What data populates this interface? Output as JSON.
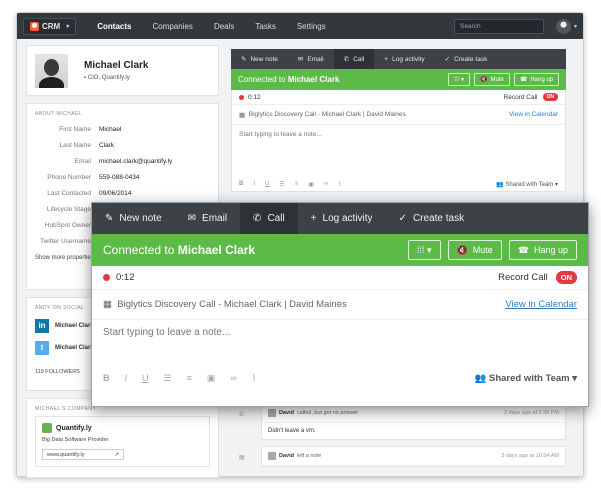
{
  "topnav": {
    "app_label": "CRM",
    "items": [
      "Contacts",
      "Companies",
      "Deals",
      "Tasks",
      "Settings"
    ],
    "search_placeholder": "Search"
  },
  "profile": {
    "name": "Michael Clark",
    "title": "CIO, Quantify.ly"
  },
  "about": {
    "section_label": "ABOUT MICHAEL",
    "fields": [
      {
        "label": "First Name",
        "value": "Michael"
      },
      {
        "label": "Last Name",
        "value": "Clark"
      },
      {
        "label": "Email",
        "value": "michael.clark@quantify.ly"
      },
      {
        "label": "Phone Number",
        "value": "559-088-0434"
      },
      {
        "label": "Last Contacted",
        "value": "09/06/2014"
      },
      {
        "label": "Lifecycle Stage",
        "value": ""
      },
      {
        "label": "HubSpot Owner",
        "value": ""
      },
      {
        "label": "Twitter Username",
        "value": ""
      }
    ],
    "show_more": "Show more properties"
  },
  "social": {
    "section_label": "ANDY ON SOCIAL",
    "linkedin_name": "Michael Clark",
    "twitter_name": "Michael Clark",
    "followers": "119 FOLLOWERS"
  },
  "company": {
    "section_label": "MICHAEL'S COMPANY",
    "name": "Quantify.ly",
    "description": "Big Data Software Provider",
    "url": "www.quantify.ly"
  },
  "composer": {
    "tabs": [
      "New note",
      "Email",
      "Call",
      "Log activity",
      "Create task"
    ],
    "connected_prefix": "Connected to",
    "contact": "Michael Clark",
    "mute": "Mute",
    "hangup": "Hang up",
    "timer": "0:12",
    "record_label": "Record Call",
    "record_toggle": "ON",
    "subject": "Biglytics Discovery Call - Michael Clark | David Maines",
    "calendar_link": "View in Calendar",
    "note_placeholder": "Start typing to leave a note...",
    "shared": "Shared with Team"
  },
  "timeline": [
    {
      "author": "David",
      "action": "called, but got no answer",
      "time": "2 days ago at 2:28 PM",
      "body": "Didn't leave a vm."
    },
    {
      "author": "David",
      "action": "left a note",
      "time": "3 days ago at 10:54 AM",
      "body": ""
    }
  ],
  "colors": {
    "green": "#5cba47",
    "dark": "#3d4247",
    "red": "#e0393e",
    "link": "#2a7fc5"
  }
}
